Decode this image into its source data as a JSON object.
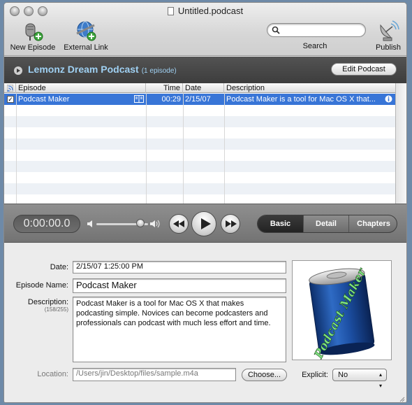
{
  "window": {
    "title": "Untitled.podcast"
  },
  "toolbar": {
    "new_episode": "New Episode",
    "external_link": "External Link",
    "search_label": "Search",
    "search_placeholder": "",
    "publish": "Publish"
  },
  "podcast": {
    "title": "Lemonz Dream Podcast",
    "count": "(1 episode)",
    "edit_label": "Edit Podcast"
  },
  "table": {
    "columns": [
      "Episode",
      "Time",
      "Date",
      "Description"
    ],
    "rows": [
      {
        "episode": "Podcast Maker",
        "time": "00:29",
        "date": "2/15/07",
        "description": "Podcast Maker is a tool for Mac OS X that..."
      }
    ]
  },
  "transport": {
    "time": "0:00:00.0",
    "tabs": [
      "Basic",
      "Detail",
      "Chapters"
    ],
    "volume_level": 0.85
  },
  "details": {
    "date_label": "Date:",
    "date_value": "2/15/07 1:25:00 PM",
    "name_label": "Episode Name:",
    "name_value": "Podcast Maker",
    "description_label": "Description:",
    "description_count": "(158/255)",
    "description_value": "Podcast Maker is a tool for Mac OS X that makes podcasting simple. Novices can become podcasters and professionals can podcast with much less effort and time.",
    "location_label": "Location:",
    "location_value": "/Users/jin/Desktop/files/sample.m4a",
    "choose_label": "Choose...",
    "explicit_label": "Explicit:",
    "explicit_value": "No",
    "artwork_text": "Podcast Maker"
  }
}
